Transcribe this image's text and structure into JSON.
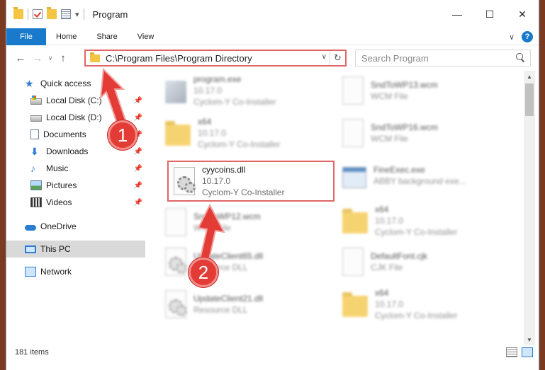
{
  "window": {
    "title": "Program",
    "controls": {
      "minimize": "—",
      "maximize": "☐",
      "close": "✕"
    }
  },
  "ribbon": {
    "tabs": [
      "File",
      "Home",
      "Share",
      "View"
    ],
    "collapse_glyph": "∨",
    "help_glyph": "?"
  },
  "navigation": {
    "back_glyph": "←",
    "forward_glyph": "→",
    "history_glyph": "∨",
    "up_glyph": "↑",
    "address": "C:\\Program Files\\Program Directory",
    "address_dropdown_glyph": "∨",
    "refresh_glyph": "↻",
    "search_placeholder": "Search Program"
  },
  "sidebar": {
    "quick_access": "Quick access",
    "items": [
      {
        "label": "Local Disk (C:)",
        "icon": "local-disk-icon",
        "pinned": true
      },
      {
        "label": "Local Disk (D:)",
        "icon": "local-disk-icon",
        "pinned": true
      },
      {
        "label": "Documents",
        "icon": "documents-icon",
        "pinned": true
      },
      {
        "label": "Downloads",
        "icon": "downloads-icon",
        "pinned": true
      },
      {
        "label": "Music",
        "icon": "music-icon",
        "pinned": true
      },
      {
        "label": "Pictures",
        "icon": "pictures-icon",
        "pinned": true
      },
      {
        "label": "Videos",
        "icon": "videos-icon",
        "pinned": true
      }
    ],
    "onedrive": "OneDrive",
    "this_pc": "This PC",
    "network": "Network",
    "pin_glyph": "📌"
  },
  "files": {
    "left": [
      {
        "name": "program.exe",
        "line2": "10.17.0",
        "line3": "Cyclom-Y Co-Installer",
        "icon": "setup-icon",
        "blurred": true
      },
      {
        "name": "x64",
        "line2": "10.17.0",
        "line3": "Cyclom-Y Co-Installer",
        "icon": "folder-icon",
        "blurred": true
      },
      {
        "name": "cyycoins.dll",
        "line2": "10.17.0",
        "line3": "Cyclom-Y Co-Installer",
        "icon": "dll-icon",
        "blurred": false
      },
      {
        "name": "SndToWP12.wcm",
        "line2": "WCM File",
        "line3": "",
        "icon": "document-icon",
        "blurred": true
      },
      {
        "name": "UpdateClient65.dll",
        "line2": "Resource DLL",
        "line3": "",
        "icon": "dll-icon",
        "blurred": true
      },
      {
        "name": "UpdateClient21.dll",
        "line2": "Resource DLL",
        "line3": "",
        "icon": "dll-icon",
        "blurred": true
      }
    ],
    "right": [
      {
        "name": "SndToWP13.wcm",
        "line2": "WCM File",
        "line3": "",
        "icon": "document-icon",
        "blurred": true
      },
      {
        "name": "SndToWP16.wcm",
        "line2": "WCM File",
        "line3": "",
        "icon": "document-icon",
        "blurred": true
      },
      {
        "name": "FineExec.exe",
        "line2": "ABBY background exe...",
        "line3": "",
        "icon": "exe-icon",
        "blurred": true
      },
      {
        "name": "x64",
        "line2": "10.17.0",
        "line3": "Cyclom-Y Co-Installer",
        "icon": "folder-icon",
        "blurred": true
      },
      {
        "name": "DefaultFont.cjk",
        "line2": "CJK File",
        "line3": "",
        "icon": "document-icon",
        "blurred": true
      },
      {
        "name": "x64",
        "line2": "10.17.0",
        "line3": "Cyclom-Y Co-Installer",
        "icon": "folder-icon",
        "blurred": true
      }
    ]
  },
  "annotations": {
    "step1": "1",
    "step2": "2",
    "color": "#e33b36"
  },
  "status": {
    "item_count": "181 items"
  },
  "colors": {
    "accent": "#1979ca",
    "highlight_border": "#e06666",
    "selected_bg": "#d9d9d9"
  }
}
